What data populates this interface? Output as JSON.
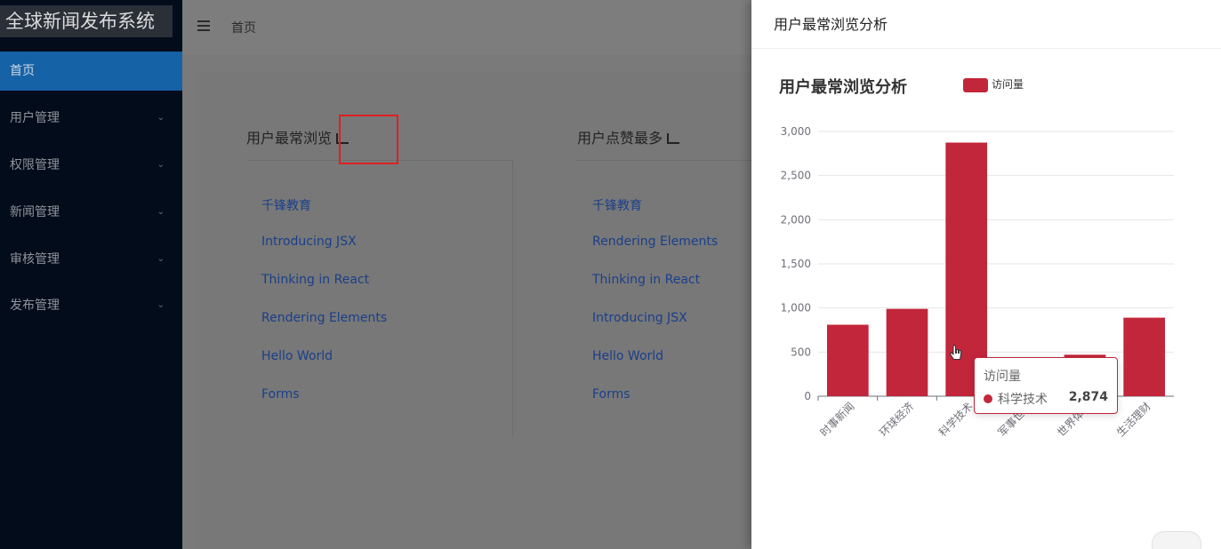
{
  "app": {
    "title": "全球新闻发布系统"
  },
  "sidebar": {
    "items": [
      {
        "label": "首页",
        "active": true
      },
      {
        "label": "用户管理",
        "active": false
      },
      {
        "label": "权限管理",
        "active": false
      },
      {
        "label": "新闻管理",
        "active": false
      },
      {
        "label": "审核管理",
        "active": false
      },
      {
        "label": "发布管理",
        "active": false
      }
    ]
  },
  "header": {
    "breadcrumb": "首页",
    "fold_icon": "menu-fold-icon"
  },
  "cards": [
    {
      "title": "用户最常浏览",
      "icon": "bar-chart-icon",
      "items": [
        "千锋教育",
        "Introducing JSX",
        "Thinking in React",
        "Rendering Elements",
        "Hello World",
        "Forms"
      ]
    },
    {
      "title": "用户点赞最多",
      "icon": "bar-chart-icon",
      "items": [
        "千锋教育",
        "Rendering Elements",
        "Thinking in React",
        "Introducing JSX",
        "Hello World",
        "Forms"
      ]
    }
  ],
  "drawer": {
    "title": "用户最常浏览分析"
  },
  "chart_data": {
    "type": "bar",
    "title": "用户最常浏览分析",
    "categories": [
      "时事新闻",
      "环球经济",
      "科学技术",
      "军事世界",
      "世界体育",
      "生活理财"
    ],
    "series": [
      {
        "name": "访问量",
        "values": [
          810,
          990,
          2874,
          0,
          470,
          890
        ]
      }
    ],
    "ylim": [
      0,
      3000
    ],
    "yticks": [
      "0",
      "500",
      "1,000",
      "1,500",
      "2,000",
      "2,500",
      "3,000"
    ],
    "color": "#c2263a",
    "legend_position": "top"
  },
  "tooltip": {
    "series": "访问量",
    "category": "科学技术",
    "value": "2,874"
  }
}
